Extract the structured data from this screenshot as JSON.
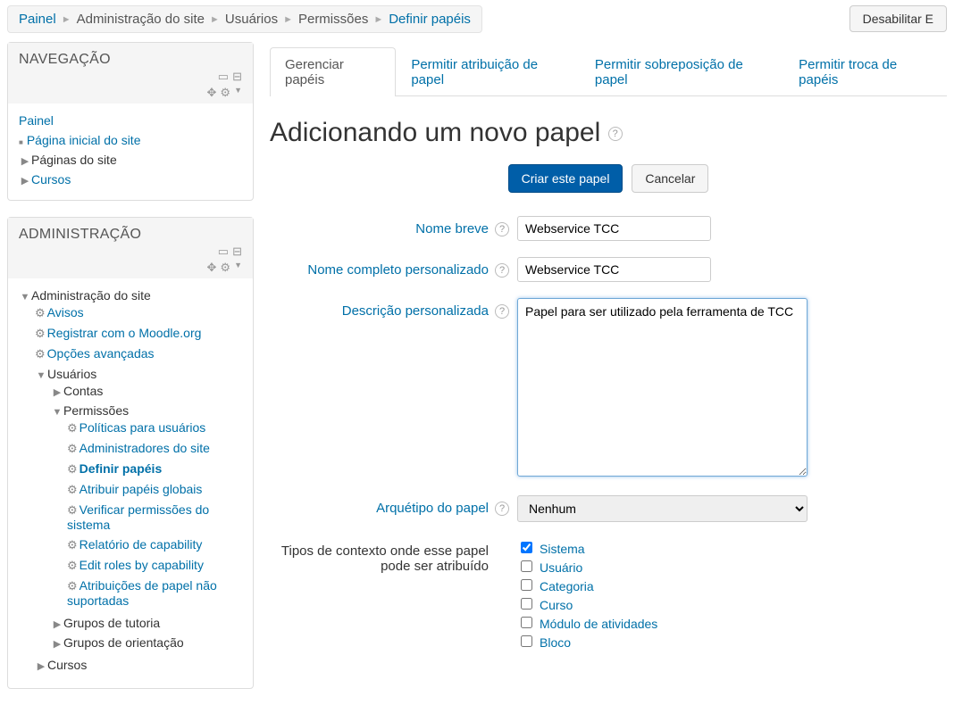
{
  "breadcrumb": [
    {
      "label": "Painel",
      "link": true
    },
    {
      "label": "Administração do site",
      "link": false
    },
    {
      "label": "Usuários",
      "link": false
    },
    {
      "label": "Permissões",
      "link": false
    },
    {
      "label": "Definir papéis",
      "link": true
    }
  ],
  "disable_button": "Desabilitar E",
  "nav_block": {
    "title": "NAVEGAÇÃO",
    "items": {
      "painel": "Painel",
      "pagina_inicial": "Página inicial do site",
      "paginas_site": "Páginas do site",
      "cursos": "Cursos"
    }
  },
  "admin_block": {
    "title": "ADMINISTRAÇÃO",
    "root": "Administração do site",
    "avisos": "Avisos",
    "registrar": "Registrar com o Moodle.org",
    "opcoes": "Opções avançadas",
    "usuarios": "Usuários",
    "contas": "Contas",
    "permissoes": "Permissões",
    "perm_items": {
      "politicas": "Políticas para usuários",
      "admins": "Administradores do site",
      "definir": "Definir papéis",
      "atribuir_globais": "Atribuir papéis globais",
      "verificar": "Verificar permissões do sistema",
      "relatorio": "Relatório de capability",
      "edit_roles": "Edit roles by capability",
      "nao_suportadas": "Atribuições de papel não suportadas"
    },
    "grupos_tutoria": "Grupos de tutoria",
    "grupos_orientacao": "Grupos de orientação",
    "cursos": "Cursos"
  },
  "tabs": {
    "gerenciar": "Gerenciar papéis",
    "permitir_atrib": "Permitir atribuição de papel",
    "permitir_sobre": "Permitir sobreposição de papel",
    "permitir_troca": "Permitir troca de papéis"
  },
  "page_title": "Adicionando um novo papel",
  "buttons": {
    "create": "Criar este papel",
    "cancel": "Cancelar"
  },
  "form": {
    "nome_breve_label": "Nome breve",
    "nome_breve_value": "Webservice TCC",
    "nome_completo_label": "Nome completo personalizado",
    "nome_completo_value": "Webservice TCC",
    "descricao_label": "Descrição personalizada",
    "descricao_value": "Papel para ser utilizado pela ferramenta de TCC",
    "arquetipo_label": "Arquétipo do papel",
    "arquetipo_value": "Nenhum",
    "contextos_label": "Tipos de contexto onde esse papel pode ser atribuído",
    "contextos": [
      {
        "label": "Sistema",
        "checked": true
      },
      {
        "label": "Usuário",
        "checked": false
      },
      {
        "label": "Categoria",
        "checked": false
      },
      {
        "label": "Curso",
        "checked": false
      },
      {
        "label": "Módulo de atividades",
        "checked": false
      },
      {
        "label": "Bloco",
        "checked": false
      }
    ]
  }
}
